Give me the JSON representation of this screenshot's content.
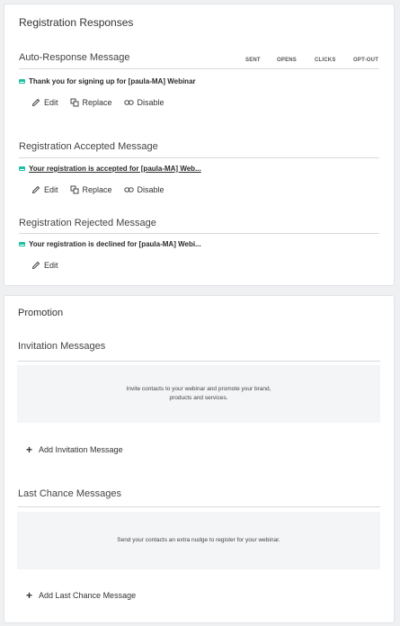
{
  "registration": {
    "title": "Registration Responses",
    "columns": {
      "sent": "SENT",
      "opens": "OPENS",
      "clicks": "CLICKS",
      "optout": "OPT-OUT"
    },
    "auto": {
      "section_title": "Auto-Response Message",
      "subject": "Thank you for signing up for [paula-MA] Webinar",
      "edit": "Edit",
      "replace": "Replace",
      "disable": "Disable"
    },
    "accepted": {
      "section_title": "Registration Accepted Message",
      "subject": "Your registration is accepted for [paula-MA] Web...",
      "edit": "Edit",
      "replace": "Replace",
      "disable": "Disable"
    },
    "rejected": {
      "section_title": "Registration Rejected Message",
      "subject": "Your registration is declined for [paula-MA] Webi...",
      "edit": "Edit"
    }
  },
  "promotion": {
    "title": "Promotion",
    "invitation": {
      "section_title": "Invitation Messages",
      "empty_line1": "Invite contacts to your webinar and promote your brand,",
      "empty_line2": "products and services.",
      "add_label": "Add Invitation Message"
    },
    "last_chance": {
      "section_title": "Last Chance Messages",
      "empty_text": "Send your contacts an extra nudge to register for your webinar.",
      "add_label": "Add Last Chance Message"
    }
  },
  "colors": {
    "accent": "#1fbfa4",
    "empty_bg": "#f4f5f6",
    "page_bg": "#eef0f2"
  }
}
